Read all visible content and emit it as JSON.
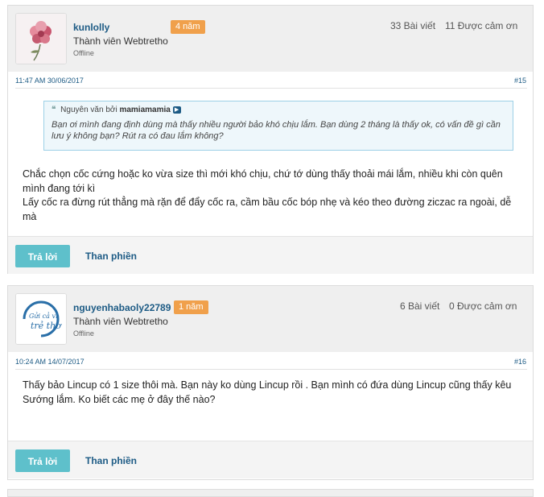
{
  "posts": [
    {
      "username": "kunlolly",
      "badge": "4 năm",
      "rank": "Thành viên Webtretho",
      "status": "Offline",
      "posts_count": "33 Bài viết",
      "thanks_count": "11 Được cảm ơn",
      "time": "11:47 AM 30/06/2017",
      "number": "#15",
      "quote": {
        "prefix": "Nguyên văn bởi",
        "author": "mamiamamia",
        "text": "Bạn ơi mình đang định dùng mà thấy nhiều người bảo khó chịu lắm. Bạn dùng 2 tháng là thấy ok, có vấn đề gì cần lưu ý không bạn? Rút ra có đau lắm không?"
      },
      "body": [
        "Chắc chọn cốc cứng hoặc ko vừa size thì mới khó chịu, chứ tớ dùng thấy thoải mái lắm, nhiều khi còn quên mình đang tới kì",
        "Lấy cốc ra đừng rút thẳng mà rặn để đẩy cốc ra, cầm bầu cốc bóp nhẹ và kéo theo đường ziczac ra ngoài, dễ mà"
      ],
      "reply_label": "Trả lời",
      "complain_label": "Than phiền"
    },
    {
      "username": "nguyenhabaoly22789",
      "badge": "1 năm",
      "rank": "Thành viên Webtretho",
      "status": "Offline",
      "avatar_text": [
        "Gửi cả vì",
        "trẻ thơ"
      ],
      "posts_count": "6 Bài viết",
      "thanks_count": "0 Được cảm ơn",
      "time": "10:24 AM 14/07/2017",
      "number": "#16",
      "body": [
        "Thấy bảo Lincup có 1 size thôi mà. Bạn này ko dùng Lincup rồi . Bạn mình có đứa dùng Lincup cũng thấy kêu Sướng lắm. Ko biết các mẹ ở đây thế nào?"
      ],
      "reply_label": "Trả lời",
      "complain_label": "Than phiền"
    }
  ]
}
